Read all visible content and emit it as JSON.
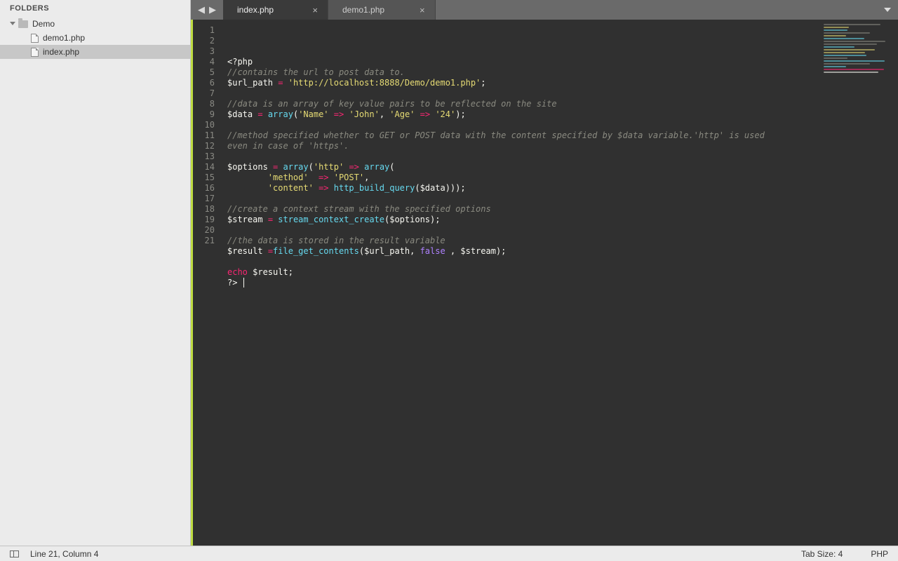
{
  "sidebar": {
    "header": "FOLDERS",
    "root": {
      "name": "Demo",
      "expanded": true
    },
    "files": [
      {
        "name": "demo1.php",
        "selected": false
      },
      {
        "name": "index.php",
        "selected": true
      }
    ]
  },
  "tabs": {
    "items": [
      {
        "label": "index.php",
        "active": true
      },
      {
        "label": "demo1.php",
        "active": false
      }
    ],
    "nav_back": "◀",
    "nav_fwd": "▶"
  },
  "code": {
    "line_count": 21,
    "lines": [
      [
        {
          "t": "tag",
          "v": "<?php"
        }
      ],
      [
        {
          "t": "comment",
          "v": "//contains the url to post data to."
        }
      ],
      [
        {
          "t": "var",
          "v": "$url_path"
        },
        {
          "t": "var",
          "v": " "
        },
        {
          "t": "op",
          "v": "="
        },
        {
          "t": "var",
          "v": " "
        },
        {
          "t": "str",
          "v": "'http://localhost:8888/Demo/demo1.php'"
        },
        {
          "t": "var",
          "v": ";"
        }
      ],
      [],
      [
        {
          "t": "comment",
          "v": "//data is an array of key value pairs to be reflected on the site"
        }
      ],
      [
        {
          "t": "var",
          "v": "$data"
        },
        {
          "t": "var",
          "v": " "
        },
        {
          "t": "op",
          "v": "="
        },
        {
          "t": "var",
          "v": " "
        },
        {
          "t": "func",
          "v": "array"
        },
        {
          "t": "var",
          "v": "("
        },
        {
          "t": "str",
          "v": "'Name'"
        },
        {
          "t": "var",
          "v": " "
        },
        {
          "t": "op",
          "v": "=>"
        },
        {
          "t": "var",
          "v": " "
        },
        {
          "t": "str",
          "v": "'John'"
        },
        {
          "t": "var",
          "v": ", "
        },
        {
          "t": "str",
          "v": "'Age'"
        },
        {
          "t": "var",
          "v": " "
        },
        {
          "t": "op",
          "v": "=>"
        },
        {
          "t": "var",
          "v": " "
        },
        {
          "t": "str",
          "v": "'24'"
        },
        {
          "t": "var",
          "v": ");"
        }
      ],
      [],
      [
        {
          "t": "comment",
          "v": "//method specified whether to GET or POST data with the content specified by $data variable.'http' is used even in case of 'https'."
        }
      ],
      [],
      [
        {
          "t": "var",
          "v": "$options"
        },
        {
          "t": "var",
          "v": " "
        },
        {
          "t": "op",
          "v": "="
        },
        {
          "t": "var",
          "v": " "
        },
        {
          "t": "func",
          "v": "array"
        },
        {
          "t": "var",
          "v": "("
        },
        {
          "t": "str",
          "v": "'http'"
        },
        {
          "t": "var",
          "v": " "
        },
        {
          "t": "op",
          "v": "=>"
        },
        {
          "t": "var",
          "v": " "
        },
        {
          "t": "func",
          "v": "array"
        },
        {
          "t": "var",
          "v": "("
        }
      ],
      [
        {
          "t": "var",
          "v": "        "
        },
        {
          "t": "str",
          "v": "'method'"
        },
        {
          "t": "var",
          "v": "  "
        },
        {
          "t": "op",
          "v": "=>"
        },
        {
          "t": "var",
          "v": " "
        },
        {
          "t": "str",
          "v": "'POST'"
        },
        {
          "t": "var",
          "v": ","
        }
      ],
      [
        {
          "t": "var",
          "v": "        "
        },
        {
          "t": "str",
          "v": "'content'"
        },
        {
          "t": "var",
          "v": " "
        },
        {
          "t": "op",
          "v": "=>"
        },
        {
          "t": "var",
          "v": " "
        },
        {
          "t": "func",
          "v": "http_build_query"
        },
        {
          "t": "var",
          "v": "($data)));"
        }
      ],
      [],
      [
        {
          "t": "comment",
          "v": "//create a context stream with the specified options"
        }
      ],
      [
        {
          "t": "var",
          "v": "$stream"
        },
        {
          "t": "var",
          "v": " "
        },
        {
          "t": "op",
          "v": "="
        },
        {
          "t": "var",
          "v": " "
        },
        {
          "t": "func",
          "v": "stream_context_create"
        },
        {
          "t": "var",
          "v": "($options);"
        }
      ],
      [],
      [
        {
          "t": "comment",
          "v": "//the data is stored in the result variable"
        }
      ],
      [
        {
          "t": "var",
          "v": "$result"
        },
        {
          "t": "var",
          "v": " "
        },
        {
          "t": "op",
          "v": "="
        },
        {
          "t": "func",
          "v": "file_get_contents"
        },
        {
          "t": "var",
          "v": "($url_path, "
        },
        {
          "t": "false",
          "v": "false"
        },
        {
          "t": "var",
          "v": " , $stream);"
        }
      ],
      [],
      [
        {
          "t": "kw",
          "v": "echo"
        },
        {
          "t": "var",
          "v": " $result;"
        }
      ],
      [
        {
          "t": "tag",
          "v": "?>"
        },
        {
          "t": "var",
          "v": " "
        }
      ]
    ]
  },
  "status": {
    "position": "Line 21, Column 4",
    "tab_size": "Tab Size: 4",
    "language": "PHP"
  },
  "colors": {
    "accent": "#bedc42",
    "comment": "#8a8a80",
    "keyword": "#f92672",
    "function": "#66d9ef",
    "string": "#e6db74",
    "constant": "#ae81ff"
  }
}
